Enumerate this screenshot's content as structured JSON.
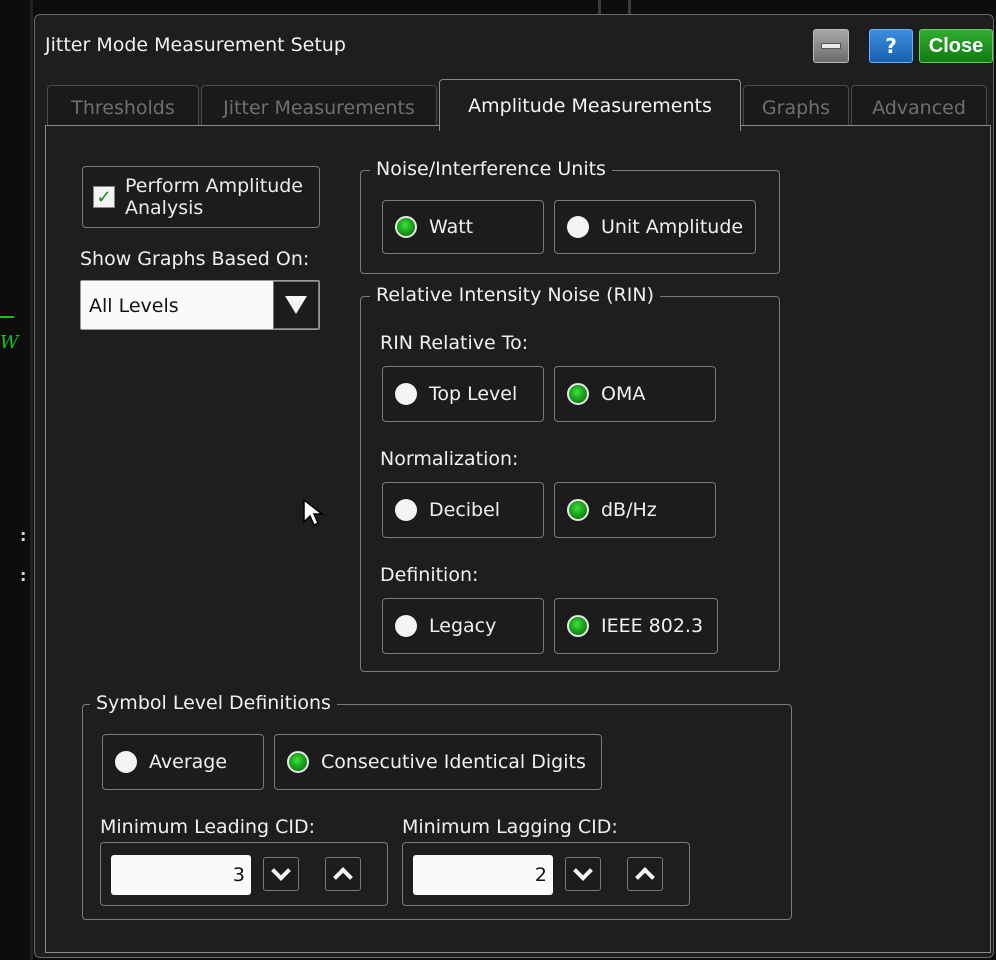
{
  "dialog": {
    "title": "Jitter Mode Measurement Setup",
    "buttons": {
      "help": "?",
      "close": "Close"
    }
  },
  "tabs": [
    {
      "label": "Thresholds",
      "active": false
    },
    {
      "label": "Jitter Measurements",
      "active": false
    },
    {
      "label": "Amplitude Measurements",
      "active": true
    },
    {
      "label": "Graphs",
      "active": false
    },
    {
      "label": "Advanced",
      "active": false
    }
  ],
  "amplitude": {
    "perform_analysis": {
      "label_line1": "Perform Amplitude",
      "label_line2": "Analysis",
      "checked": true
    },
    "show_graphs_label": "Show Graphs Based On:",
    "show_graphs_value": "All Levels"
  },
  "noise_units": {
    "legend": "Noise/Interference Units",
    "options": [
      {
        "label": "Watt",
        "selected": true
      },
      {
        "label": "Unit Amplitude",
        "selected": false
      }
    ]
  },
  "rin": {
    "legend": "Relative Intensity Noise (RIN)",
    "relative_to_label": "RIN Relative To:",
    "relative_to": [
      {
        "label": "Top Level",
        "selected": false
      },
      {
        "label": "OMA",
        "selected": true
      }
    ],
    "normalization_label": "Normalization:",
    "normalization": [
      {
        "label": "Decibel",
        "selected": false
      },
      {
        "label": "dB/Hz",
        "selected": true
      }
    ],
    "definition_label": "Definition:",
    "definition": [
      {
        "label": "Legacy",
        "selected": false
      },
      {
        "label": "IEEE 802.3",
        "selected": true
      }
    ]
  },
  "symbol_levels": {
    "legend": "Symbol Level Definitions",
    "options": [
      {
        "label": "Average",
        "selected": false
      },
      {
        "label": "Consecutive Identical Digits",
        "selected": true
      }
    ],
    "min_leading_label": "Minimum Leading CID:",
    "min_leading_value": "3",
    "min_lagging_label": "Minimum Lagging CID:",
    "min_lagging_value": "2"
  },
  "colors": {
    "dialog_bg": "#1e1e1e",
    "accent_green": "#1aa81a",
    "help_blue": "#1a5fb0"
  }
}
